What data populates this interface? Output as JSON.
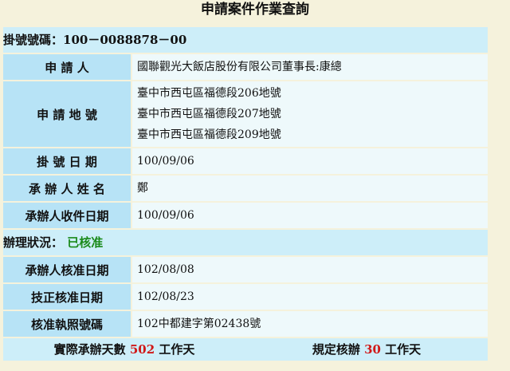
{
  "page_title": "申請案件作業查詢",
  "register": {
    "label": "掛號號碼：",
    "number": "100－0088878－00"
  },
  "fields": [
    {
      "label": "申 請 人",
      "values": [
        "國聯觀光大飯店股份有限公司董事長:康總"
      ]
    },
    {
      "label": "申 請 地 號",
      "values": [
        "臺中市西屯區福德段206地號",
        "臺中市西屯區福德段207地號",
        "臺中市西屯區福德段209地號"
      ]
    },
    {
      "label": "掛 號 日 期",
      "values": [
        "100/09/06"
      ]
    },
    {
      "label": "承 辦 人 姓 名",
      "values": [
        "鄭"
      ]
    },
    {
      "label": "承辦人收件日期",
      "values": [
        "100/09/06"
      ]
    }
  ],
  "status": {
    "label": "辦理狀況：",
    "value": "已核准"
  },
  "fields2": [
    {
      "label": "承辦人核准日期",
      "values": [
        "102/08/08"
      ]
    },
    {
      "label": "技正核准日期",
      "values": [
        "102/08/23"
      ]
    },
    {
      "label": "核准執照號碼",
      "values": [
        "102中都建字第02438號"
      ]
    }
  ],
  "footer": {
    "actual_prefix": "實際承辦天數",
    "actual_days": "502",
    "actual_suffix": "工作天",
    "rule_prefix": "規定核辦",
    "rule_days": "30",
    "rule_suffix": "工作天"
  }
}
